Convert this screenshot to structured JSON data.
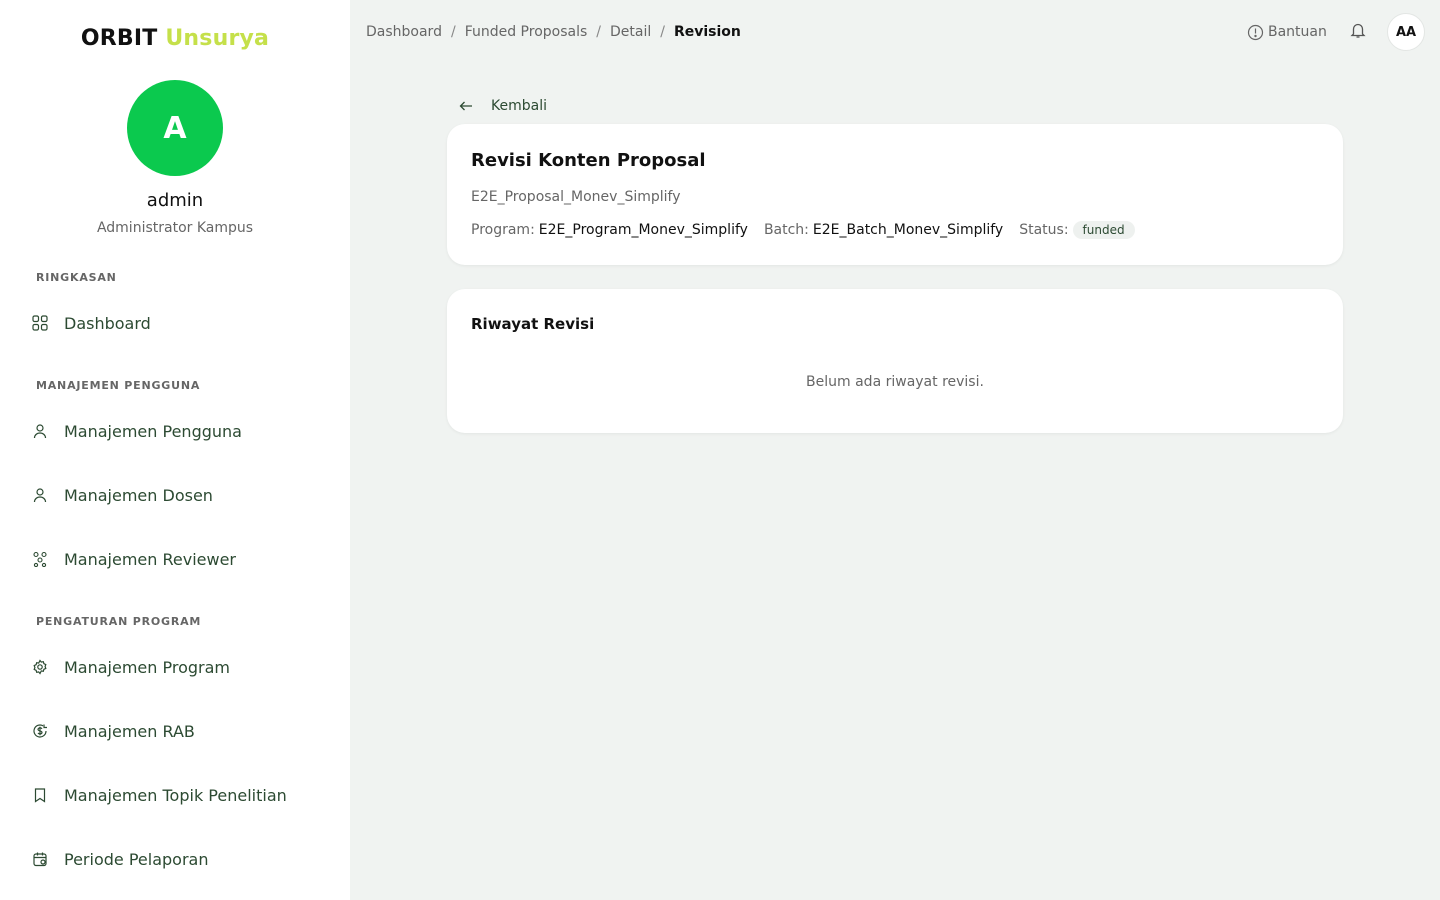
{
  "brand": {
    "part1": "ORBIT",
    "part2": "Unsurya"
  },
  "user": {
    "initial": "A",
    "name": "admin",
    "role": "Administrator Kampus"
  },
  "sidebar": {
    "sections": [
      {
        "label": "RINGKASAN"
      },
      {
        "label": "MANAJEMEN PENGGUNA"
      },
      {
        "label": "PENGATURAN PROGRAM"
      }
    ],
    "items": [
      {
        "label": "Dashboard",
        "icon": "grid-icon"
      },
      {
        "label": "Manajemen Pengguna",
        "icon": "user-icon"
      },
      {
        "label": "Manajemen Dosen",
        "icon": "user-icon"
      },
      {
        "label": "Manajemen Reviewer",
        "icon": "users-network-icon"
      },
      {
        "label": "Manajemen Program",
        "icon": "gear-icon"
      },
      {
        "label": "Manajemen RAB",
        "icon": "money-icon"
      },
      {
        "label": "Manajemen Topik Penelitian",
        "icon": "bookmark-icon"
      },
      {
        "label": "Periode Pelaporan",
        "icon": "calendar-icon"
      }
    ]
  },
  "breadcrumb": {
    "items": [
      "Dashboard",
      "Funded Proposals",
      "Detail"
    ],
    "current": "Revision",
    "separator": "/"
  },
  "header": {
    "help_label": "Bantuan",
    "avatar_initials": "AA"
  },
  "back_label": "Kembali",
  "proposal": {
    "title": "Revisi Konten Proposal",
    "name": "E2E_Proposal_Monev_Simplify",
    "program_label": "Program:",
    "program": "E2E_Program_Monev_Simplify",
    "batch_label": "Batch:",
    "batch": "E2E_Batch_Monev_Simplify",
    "status_label": "Status:",
    "status": "funded"
  },
  "history": {
    "title": "Riwayat Revisi",
    "empty_text": "Belum ada riwayat revisi."
  },
  "colors": {
    "accent_green": "#0bc94e",
    "brand_lime": "#c5e04a",
    "nav_text": "#2c4a32",
    "background": "#f0f3f1"
  }
}
